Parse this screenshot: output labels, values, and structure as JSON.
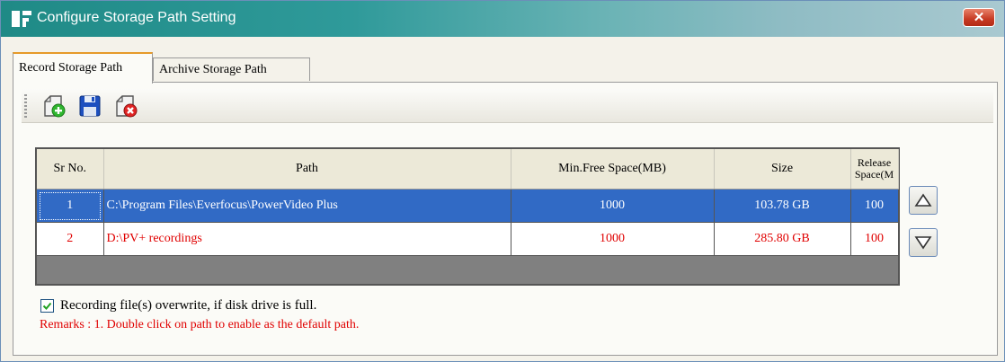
{
  "window": {
    "title": "Configure Storage Path Setting",
    "close_label": "✕"
  },
  "tabs": [
    {
      "label": "Record Storage Path",
      "active": true
    },
    {
      "label": "Archive Storage Path",
      "active": false
    }
  ],
  "toolbar": {
    "buttons": [
      {
        "icon": "add-folder-icon"
      },
      {
        "icon": "save-icon"
      },
      {
        "icon": "delete-folder-icon"
      }
    ]
  },
  "table": {
    "headers": [
      "Sr No.",
      "Path",
      "Min.Free Space(MB)",
      "Size",
      "Release Space(MB)"
    ],
    "header_visible": {
      "release_line1": "Release",
      "release_line2": "Space(M"
    },
    "rows": [
      {
        "sr": "1",
        "path": "C:\\Program Files\\Everfocus\\PowerVideo Plus",
        "min_free": "1000",
        "size": "103.78 GB",
        "release": "100",
        "selected": true
      },
      {
        "sr": "2",
        "path": "D:\\PV+ recordings",
        "min_free": "1000",
        "size": "285.80 GB",
        "release": "100",
        "selected": false
      }
    ]
  },
  "side_buttons": {
    "up_icon": "up-arrow-icon",
    "down_icon": "down-arrow-icon"
  },
  "options": {
    "overwrite_checked": true,
    "overwrite_label": "Recording file(s) overwrite, if disk drive is full."
  },
  "remarks": "Remarks : 1. Double click on path to enable as the default  path.",
  "colors": {
    "selection": "#316ac5",
    "remark_red": "#e00000",
    "title_teal": "#1f8a86"
  }
}
